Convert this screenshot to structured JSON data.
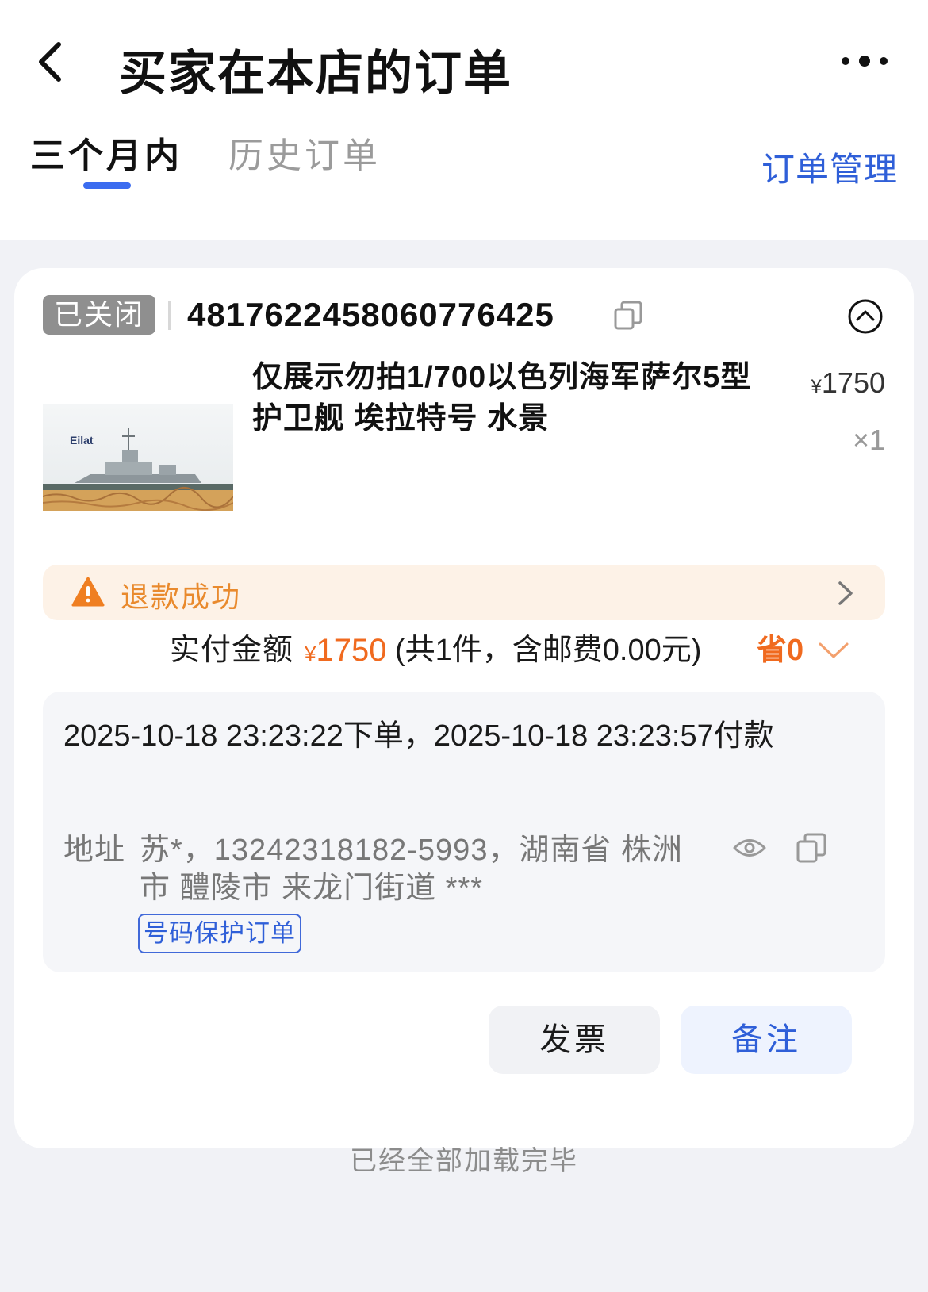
{
  "header": {
    "title": "买家在本店的订单"
  },
  "tabs": [
    {
      "label": "三个月内",
      "active": true
    },
    {
      "label": "历史订单",
      "active": false
    }
  ],
  "manage_label": "订单管理",
  "order": {
    "status": "已关闭",
    "order_no": "4817622458060776425",
    "product": {
      "title": "仅展示勿拍1/700以色列海军萨尔5型护卫舰 埃拉特号 水景",
      "thumb_label": "Eilat",
      "currency": "¥",
      "price": "1750",
      "qty": "×1"
    },
    "refund": {
      "label": "退款成功"
    },
    "payment": {
      "label": "实付金额",
      "currency": "¥",
      "amount": "1750",
      "detail": "(共1件，含邮费0.00元)",
      "save": "省0"
    },
    "time_text": "2025-10-18 23:23:22下单，2025-10-18 23:23:57付款",
    "address": {
      "label": "地址",
      "value": "苏*，13242318182-5993，湖南省 株洲市 醴陵市 来龙门街道 ***",
      "tag": "号码保护订单"
    },
    "buttons": {
      "invoice": "发票",
      "remark": "备注"
    }
  },
  "footer": "已经全部加载完毕",
  "colors": {
    "accent_blue": "#3b6cf0",
    "orange": "#f06a1f",
    "warn_bg": "#fdf2e7"
  }
}
